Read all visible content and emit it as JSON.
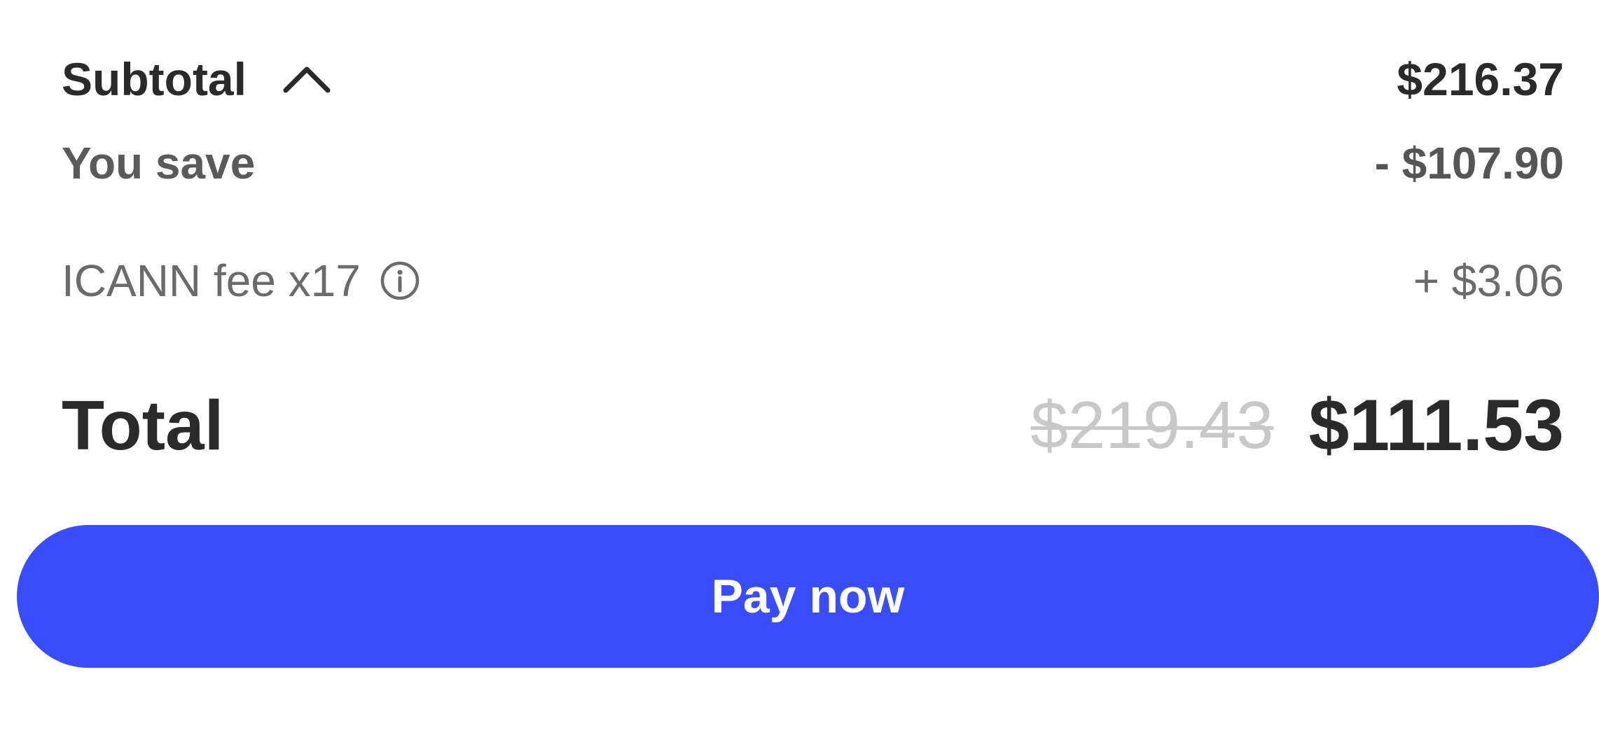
{
  "summary": {
    "subtotal_label": "Subtotal",
    "subtotal_value": "$216.37",
    "save_label": "You save",
    "save_value": "- $107.90",
    "icann_label": "ICANN fee x17",
    "icann_value": "+ $3.06",
    "total_label": "Total",
    "total_original": "$219.43",
    "total_final": "$111.53"
  },
  "actions": {
    "pay_label": "Pay now"
  },
  "icons": {
    "subtotal_toggle": "chevron-up-icon",
    "icann_info": "info-icon"
  },
  "colors": {
    "accent": "#3a4dfd",
    "text_primary": "#2a2a2a",
    "text_secondary": "#6b6b6b",
    "strikethrough": "#c8c8c8"
  }
}
